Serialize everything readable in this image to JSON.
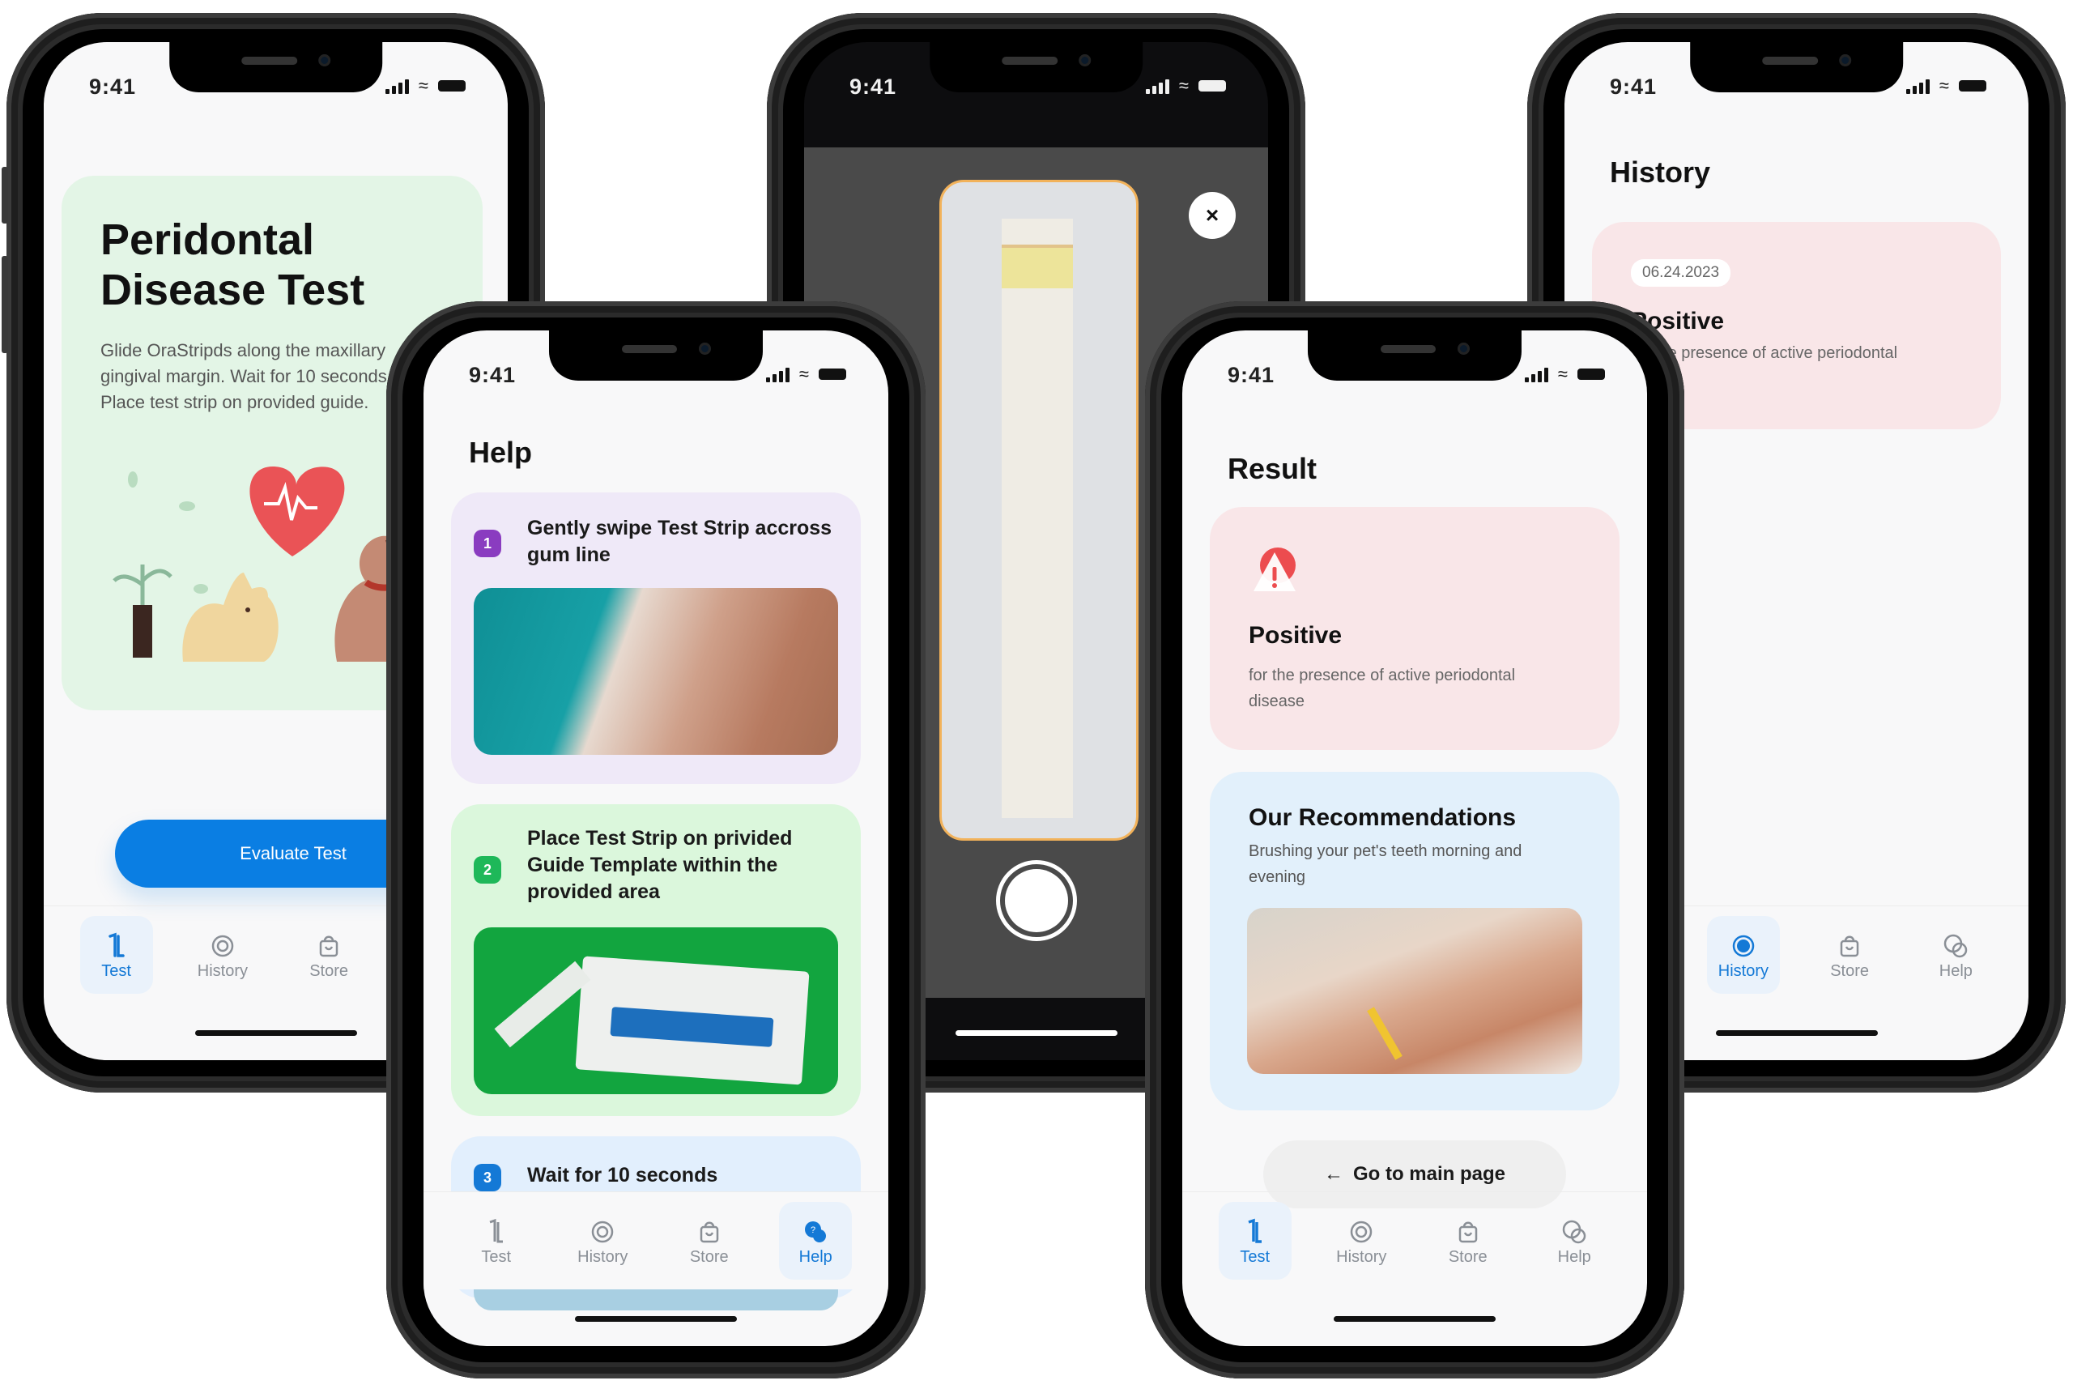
{
  "status_bar": {
    "time": "9:41"
  },
  "tabs": {
    "test": "Test",
    "history": "History",
    "store": "Store",
    "help": "Help"
  },
  "colors": {
    "accent": "#0a7ee3",
    "positive_card": "#f9e6e8",
    "recommend_card": "#e2f0fb",
    "hero_card": "#e3f5e6",
    "step1": "#efe9f8",
    "step2": "#dbf7dc",
    "step3": "#e2effd"
  },
  "test_screen": {
    "title_line1": "Peridontal",
    "title_line2": "Disease Test",
    "description": "Glide OraStripds along the maxillary\ngingival margin. Wait for 10 seconds.\nPlace test strip on provided guide.",
    "illustration": "heart-pulse-cat-dog-plant",
    "evaluate_button": "Evaluate Test",
    "active_tab": "test"
  },
  "help_screen": {
    "title": "Help",
    "steps": [
      {
        "number": "1",
        "text": "Gently swipe Test Strip accross gum line",
        "image": "dog-teeth-photo"
      },
      {
        "number": "2",
        "text": "Place Test Strip on privided Guide Template within the provided area",
        "image": "orastripdx-kit-photo"
      },
      {
        "number": "3",
        "text": "Wait for 10 seconds",
        "image": "step-3-photo"
      }
    ],
    "active_tab": "help"
  },
  "camera_screen": {
    "close_icon": "×",
    "shutter": "capture-button"
  },
  "result_screen": {
    "title": "Result",
    "result_label": "Positive",
    "result_description": "for the presence of active periodontal disease",
    "recommendations_title": "Our Recommendations",
    "recommendations_text": "Brushing your pet's teeth morning and evening",
    "recommendations_image": "dog-tooth-brushing-photo",
    "go_main_button": "Go to main page",
    "go_main_arrow": "←",
    "active_tab": "test"
  },
  "history_screen": {
    "title": "History",
    "entries": [
      {
        "date": "06.24.2023",
        "result": "Positive",
        "description": "for the presence of active periodontal"
      }
    ],
    "active_tab": "history"
  }
}
